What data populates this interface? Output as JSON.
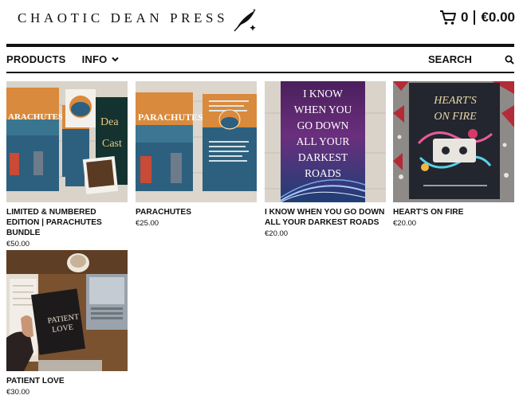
{
  "header": {
    "brand": "CHAOTIC DEAN PRESS",
    "logo": "feather-quill-icon",
    "cart_count": "0",
    "cart_total": "€0.00"
  },
  "nav": {
    "products_label": "PRODUCTS",
    "info_label": "INFO",
    "search_placeholder": "SEARCH"
  },
  "products": [
    {
      "title": "LIMITED & NUMBERED EDITION | PARACHUTES BUNDLE",
      "price": "€50.00",
      "cover_text": "PARACHUTES"
    },
    {
      "title": "PARACHUTES",
      "price": "€25.00",
      "cover_text": "PARACHUTES"
    },
    {
      "title": "I KNOW WHEN YOU GO DOWN ALL YOUR DARKEST ROADS",
      "price": "€20.00",
      "cover_text": "I KNOW WHEN YOU GO DOWN ALL YOUR DARKEST ROADS"
    },
    {
      "title": "HEART'S ON FIRE",
      "price": "€20.00",
      "cover_text": "HEART'S ON FIRE"
    },
    {
      "title": "PATIENT LOVE",
      "price": "€30.00",
      "cover_text": "PATIENT LOVE"
    }
  ],
  "colors": {
    "text": "#111111",
    "background": "#ffffff",
    "wood": "#d9d2c8",
    "parachutes_blue": "#2c5f7c",
    "parachutes_orange": "#d8843a",
    "darkest_roads_purple": "#5a2d6e",
    "hearts_bg": "#2a2d35"
  }
}
